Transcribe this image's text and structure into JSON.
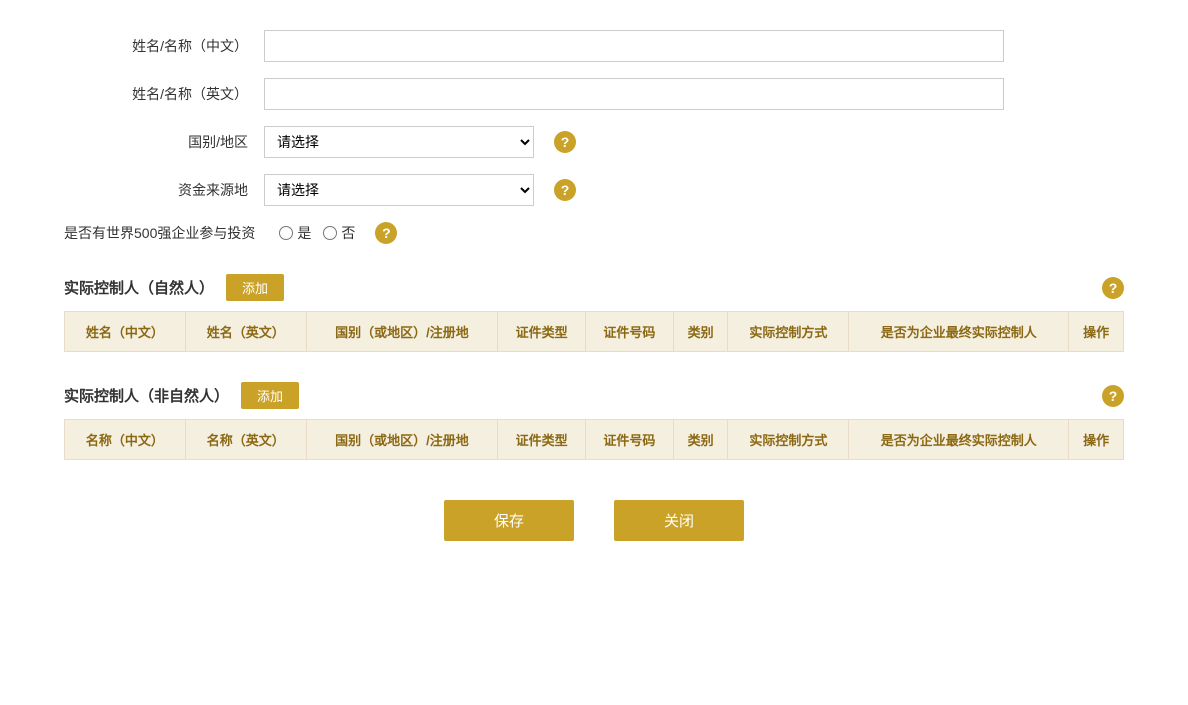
{
  "form": {
    "name_cn_label": "姓名/名称（中文）",
    "name_en_label": "姓名/名称（英文）",
    "country_label": "国别/地区",
    "country_placeholder": "请选择",
    "fund_source_label": "资金来源地",
    "fund_source_placeholder": "请选择",
    "fortune500_label": "是否有世界500强企业参与投资",
    "yes_label": "是",
    "no_label": "否",
    "help_icon_char": "?"
  },
  "section1": {
    "title": "实际控制人（自然人）",
    "add_label": "添加",
    "columns": [
      "姓名（中文）",
      "姓名（英文）",
      "国别（或地区）/注册地",
      "证件类型",
      "证件号码",
      "类别",
      "实际控制方式",
      "是否为企业最终实际控制人",
      "操作"
    ]
  },
  "section2": {
    "title": "实际控制人（非自然人）",
    "add_label": "添加",
    "columns": [
      "名称（中文）",
      "名称（英文）",
      "国别（或地区）/注册地",
      "证件类型",
      "证件号码",
      "类别",
      "实际控制方式",
      "是否为企业最终实际控制人",
      "操作"
    ]
  },
  "buttons": {
    "save_label": "保存",
    "close_label": "关闭"
  }
}
